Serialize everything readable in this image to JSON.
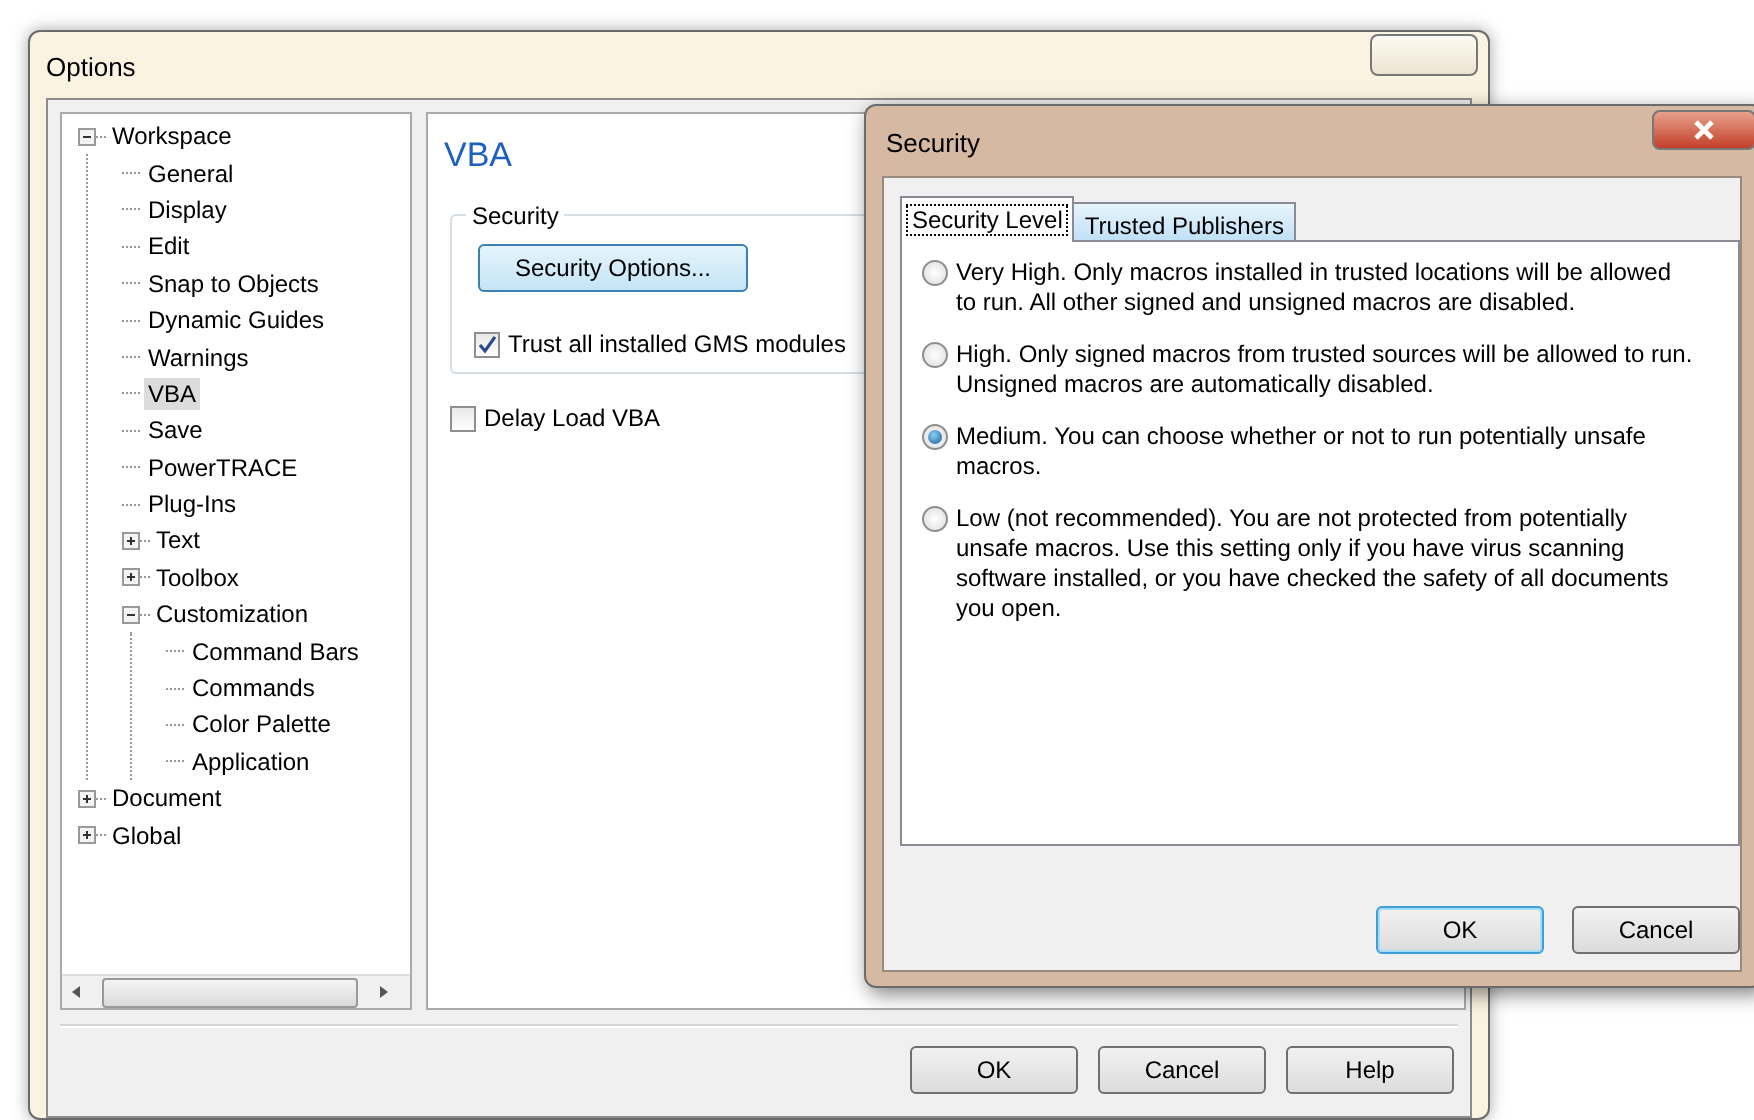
{
  "options_window": {
    "title": "Options",
    "tree": [
      {
        "label": "Workspace",
        "expanded": true,
        "selected": false,
        "children": [
          {
            "label": "General",
            "selected": false
          },
          {
            "label": "Display",
            "selected": false
          },
          {
            "label": "Edit",
            "selected": false
          },
          {
            "label": "Snap to Objects",
            "selected": false
          },
          {
            "label": "Dynamic Guides",
            "selected": false
          },
          {
            "label": "Warnings",
            "selected": false
          },
          {
            "label": "VBA",
            "selected": true
          },
          {
            "label": "Save",
            "selected": false
          },
          {
            "label": "PowerTRACE",
            "selected": false
          },
          {
            "label": "Plug-Ins",
            "selected": false
          },
          {
            "label": "Text",
            "expanded": false,
            "selected": false
          },
          {
            "label": "Toolbox",
            "expanded": false,
            "selected": false
          },
          {
            "label": "Customization",
            "expanded": true,
            "selected": false,
            "children": [
              {
                "label": "Command Bars",
                "selected": false
              },
              {
                "label": "Commands",
                "selected": false
              },
              {
                "label": "Color Palette",
                "selected": false
              },
              {
                "label": "Application",
                "selected": false
              }
            ]
          }
        ]
      },
      {
        "label": "Document",
        "expanded": false,
        "selected": false
      },
      {
        "label": "Global",
        "expanded": false,
        "selected": false
      }
    ],
    "panel": {
      "heading": "VBA",
      "group": {
        "title": "Security",
        "options_button": "Security Options...",
        "checkbox": {
          "label": "Trust all installed GMS modules",
          "checked": true
        }
      },
      "delay_checkbox": {
        "label": "Delay Load VBA",
        "checked": false
      }
    },
    "buttons": [
      "OK",
      "Cancel",
      "Help"
    ]
  },
  "security_dialog": {
    "title": "Security",
    "tabs": [
      {
        "label": "Security Level",
        "selected": true
      },
      {
        "label": "Trusted Publishers",
        "selected": false
      }
    ],
    "levels": [
      {
        "text": "Very High. Only macros installed in trusted locations will be allowed to run. All other signed and unsigned macros are disabled.",
        "selected": false
      },
      {
        "text": "High. Only signed macros from trusted sources will be allowed to run. Unsigned macros are automatically disabled.",
        "selected": false
      },
      {
        "text": "Medium. You can choose whether or not to run potentially unsafe macros.",
        "selected": true
      },
      {
        "text": "Low (not recommended). You are not protected from potentially unsafe macros. Use this setting only if you have virus scanning software installed, or you have checked the safety of all documents you open.",
        "selected": false
      }
    ],
    "buttons": [
      {
        "label": "OK",
        "default": true
      },
      {
        "label": "Cancel",
        "default": false
      }
    ]
  }
}
